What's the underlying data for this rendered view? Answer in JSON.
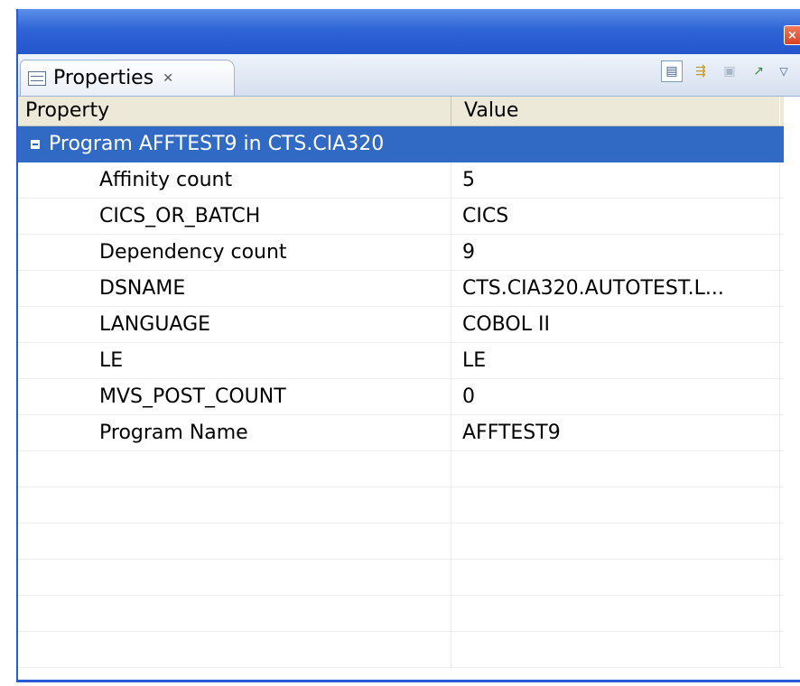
{
  "window": {
    "close_glyph": "×"
  },
  "tab": {
    "label": "Properties",
    "close_glyph": "✕"
  },
  "toolbar": {
    "icons": [
      "show-categories-icon",
      "show-advanced-icon",
      "restore-default-icon",
      "pin-icon",
      "view-menu-icon"
    ]
  },
  "table": {
    "columns": {
      "property": "Property",
      "value": "Value"
    },
    "group": {
      "label": "Program AFFTEST9 in CTS.CIA320",
      "value": ""
    },
    "rows": [
      {
        "property": "Affinity count",
        "value": "5"
      },
      {
        "property": "CICS_OR_BATCH",
        "value": "CICS"
      },
      {
        "property": "Dependency count",
        "value": "9"
      },
      {
        "property": "DSNAME",
        "value": "CTS.CIA320.AUTOTEST.L..."
      },
      {
        "property": "LANGUAGE",
        "value": "COBOL II"
      },
      {
        "property": "LE",
        "value": "LE"
      },
      {
        "property": "MVS_POST_COUNT",
        "value": "0"
      },
      {
        "property": "Program Name",
        "value": "AFFTEST9"
      }
    ]
  },
  "colors": {
    "titlebar": "#2f64d6",
    "selection": "#316ac5",
    "header_bg": "#ece9d8"
  }
}
